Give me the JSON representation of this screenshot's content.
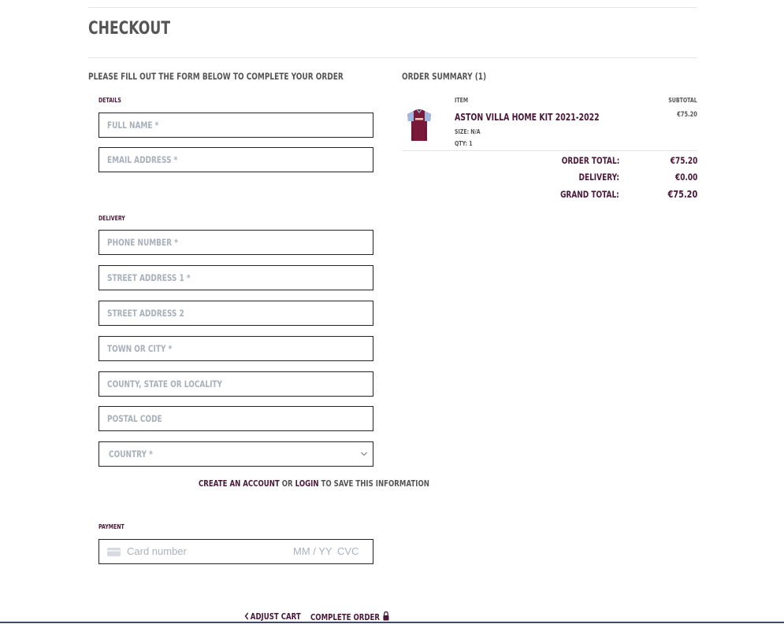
{
  "page": {
    "title": "CHECKOUT",
    "intro": "PLEASE FILL OUT THE FORM BELOW TO COMPLETE YOUR ORDER"
  },
  "form": {
    "details_label": "DETAILS",
    "details_fields": [
      {
        "placeholder": "FULL NAME *",
        "value": ""
      },
      {
        "placeholder": "EMAIL ADDRESS *",
        "value": ""
      }
    ],
    "delivery_label": "DELIVERY",
    "delivery_fields": [
      {
        "placeholder": "PHONE NUMBER *",
        "value": ""
      },
      {
        "placeholder": "STREET ADDRESS 1 *",
        "value": ""
      },
      {
        "placeholder": "STREET ADDRESS 2",
        "value": ""
      },
      {
        "placeholder": "TOWN OR CITY *",
        "value": ""
      },
      {
        "placeholder": "COUNTY, STATE OR LOCALITY",
        "value": ""
      },
      {
        "placeholder": "POSTAL CODE",
        "value": ""
      }
    ],
    "country_select": {
      "selected": "COUNTRY *"
    },
    "account_prompt": {
      "create_link": "CREATE AN ACCOUNT",
      "or_text": " OR ",
      "login_link": "LOGIN",
      "suffix": " TO SAVE THIS INFORMATION"
    },
    "payment_label": "PAYMENT",
    "card": {
      "number_placeholder": "Card number",
      "expiry_placeholder": "MM / YY",
      "cvc_placeholder": "CVC",
      "icon": "credit-card-icon"
    },
    "actions": {
      "adjust_cart": "ADJUST CART",
      "complete_order": "COMPLETE ORDER"
    }
  },
  "summary": {
    "title": "ORDER SUMMARY (1)",
    "columns": {
      "item": "ITEM",
      "subtotal": "SUBTOTAL"
    },
    "items": [
      {
        "name": "ASTON VILLA HOME KIT 2021-2022",
        "size": "SIZE: N/A",
        "qty": "QTY: 1",
        "subtotal": "€75.20",
        "image": "claret-jersey"
      }
    ],
    "totals": [
      {
        "label": "ORDER TOTAL:",
        "value": "€75.20"
      },
      {
        "label": "DELIVERY:",
        "value": "€0.00"
      },
      {
        "label": "GRAND TOTAL:",
        "value": "€75.20"
      }
    ]
  },
  "colors": {
    "accent": "#4a1838",
    "text": "#555555",
    "placeholder": "#a8b0ba",
    "jersey_claret": "#7a1a3a",
    "jersey_sky": "#9fb8e0"
  }
}
